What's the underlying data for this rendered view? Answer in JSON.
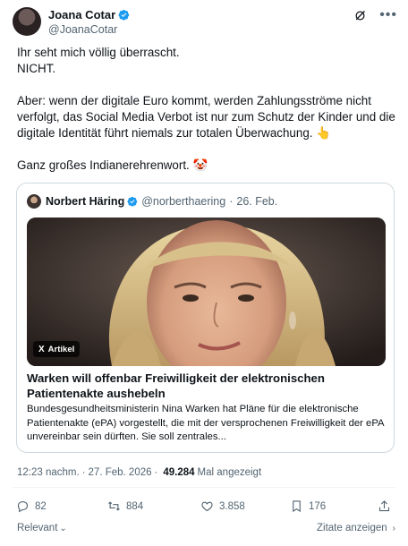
{
  "author": {
    "name": "Joana Cotar",
    "handle": "@JoanaCotar"
  },
  "icons": {
    "verified": "verified-badge-icon",
    "grok": "grok-icon",
    "more": "more-icon"
  },
  "body": {
    "line1": "Ihr seht mich völlig überrascht.",
    "line2": "NICHT.",
    "line3": "Aber: wenn der digitale Euro kommt, werden Zahlungsströme nicht verfolgt, das Social Media Verbot ist nur zum Schutz der Kinder und die digitale Identität führt niemals zur totalen Überwachung. 👆",
    "line4": "Ganz großes Indianerehrenwort. 🤡"
  },
  "quote": {
    "name": "Norbert Häring",
    "handle": "@norberthaering",
    "separator": "·",
    "date": "26. Feb.",
    "badge_label": "Artikel",
    "badge_icon": "X",
    "title": "Warken will offenbar Freiwilligkeit der elektronischen Patientenakte aushebeln",
    "description": "Bundesgesundheitsministerin Nina Warken hat Pläne für die elektronische Patientenakte (ePA) vorgestellt, die mit der versprochenen Freiwilligkeit der ePA unvereinbar sein dürften. Sie soll zentrales..."
  },
  "meta": {
    "time": "12:23 nachm.",
    "separator": "·",
    "date": "27. Feb. 2026",
    "views": "49.284",
    "views_label": "Mal angezeigt"
  },
  "actions": {
    "replies": "82",
    "reposts": "884",
    "likes": "3.858",
    "bookmarks": "176"
  },
  "bottom": {
    "sort_label": "Relevant",
    "quotes_label": "Zitate anzeigen"
  },
  "colors": {
    "text": "#0f1419",
    "secondary": "#536471",
    "verified": "#1d9bf0",
    "border": "#cfd9de"
  }
}
